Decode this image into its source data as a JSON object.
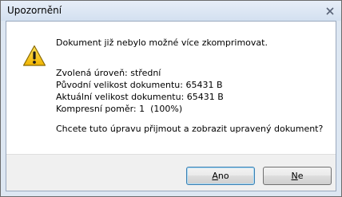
{
  "window": {
    "title": "Upozornění"
  },
  "icons": {
    "warning": "warning-icon",
    "close": "close-icon"
  },
  "message": {
    "headline": "Dokument již nebylo možné více zkomprimovat.",
    "details": [
      "Zvolená úroveň: střední",
      "Původní velikost dokumentu: 65431 B",
      "Aktuální velikost dokumentu: 65431 B",
      "Kompresní poměr: 1  (100%)"
    ],
    "question": "Chcete tuto úpravu přijmout a zobrazit upravený dokument?"
  },
  "buttons": {
    "yes": {
      "mnemonic": "A",
      "rest": "no"
    },
    "no": {
      "mnemonic": "N",
      "rest": "e"
    }
  },
  "colors": {
    "warning_fill": "#f5c400",
    "warning_border": "#8a6a00"
  }
}
